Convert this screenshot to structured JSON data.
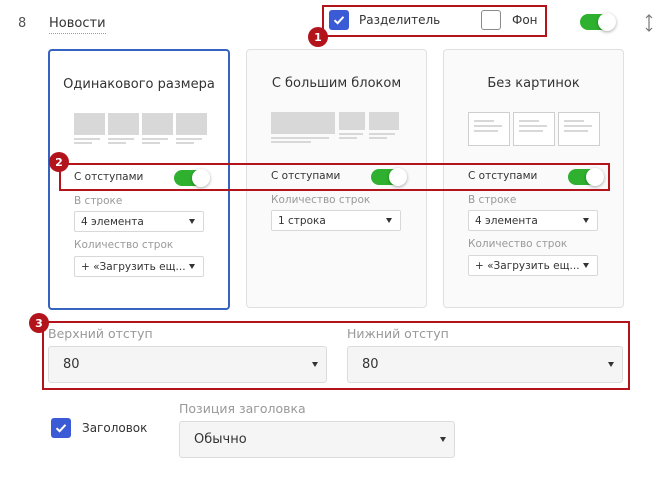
{
  "section": {
    "number": "8",
    "title": "Новости"
  },
  "topbar": {
    "separator": {
      "label": "Разделитель",
      "checked": true
    },
    "background": {
      "label": "Фон",
      "checked": false
    },
    "enabled": true
  },
  "cards": [
    {
      "title": "Одинакового размера",
      "padding_label": "С отступами",
      "per_row_label": "В строке",
      "per_row_value": "4 элемента",
      "rows_label": "Количество строк",
      "rows_value": "+ «Загрузить ещ..."
    },
    {
      "title": "С большим блоком",
      "padding_label": "С отступами",
      "rows_label": "Количество строк",
      "rows_value": "1 строка"
    },
    {
      "title": "Без картинок",
      "padding_label": "С отступами",
      "per_row_label": "В строке",
      "per_row_value": "4 элемента",
      "rows_label": "Количество строк",
      "rows_value": "+ «Загрузить ещ..."
    }
  ],
  "spacing": {
    "top_label": "Верхний отступ",
    "top_value": "80",
    "bottom_label": "Нижний отступ",
    "bottom_value": "80"
  },
  "heading": {
    "checkbox_label": "Заголовок",
    "checked": true,
    "position_label": "Позиция заголовка",
    "position_value": "Обычно"
  },
  "annotations": [
    "1",
    "2",
    "3"
  ],
  "colors": {
    "accent": "#3b5ad6",
    "toggle_on": "#2fb12f",
    "annotation": "#b3131b",
    "selected_border": "#3763c0"
  }
}
